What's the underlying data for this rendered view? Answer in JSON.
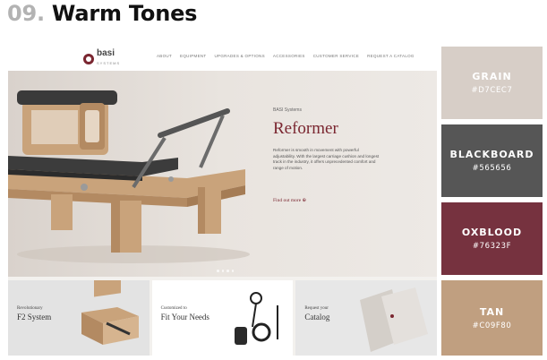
{
  "heading": {
    "number": "09.",
    "title": "Warm Tones"
  },
  "website": {
    "logo": {
      "name": "basi",
      "sub": "SYSTEMS"
    },
    "nav": [
      "ABOUT",
      "EQUIPMENT",
      "UPGRADES & OPTIONS",
      "ACCESSORIES",
      "CUSTOMER SERVICE",
      "REQUEST A CATALOG"
    ],
    "hero": {
      "brand": "BASI Systems",
      "title": "Reformer",
      "body": "Reformer is smooth in movement with powerful adjustability. With the largest carriage cushion and longest track in the industry, it offers unprecedented comfort and range of motion.",
      "link": "Find out more"
    },
    "panels": [
      {
        "small": "Revolutionary",
        "big": "F2 System"
      },
      {
        "small": "Customized to",
        "big": "Fit Your Needs"
      },
      {
        "small": "Request your",
        "big": "Catalog"
      }
    ]
  },
  "swatches": [
    {
      "name": "GRAIN",
      "hex": "#D7CEC7",
      "color": "#D7CEC7"
    },
    {
      "name": "BLACKBOARD",
      "hex": "#565656",
      "color": "#565656"
    },
    {
      "name": "OXBLOOD",
      "hex": "#76323F",
      "color": "#76323F"
    },
    {
      "name": "TAN",
      "hex": "#C09F80",
      "color": "#C09F80"
    }
  ]
}
